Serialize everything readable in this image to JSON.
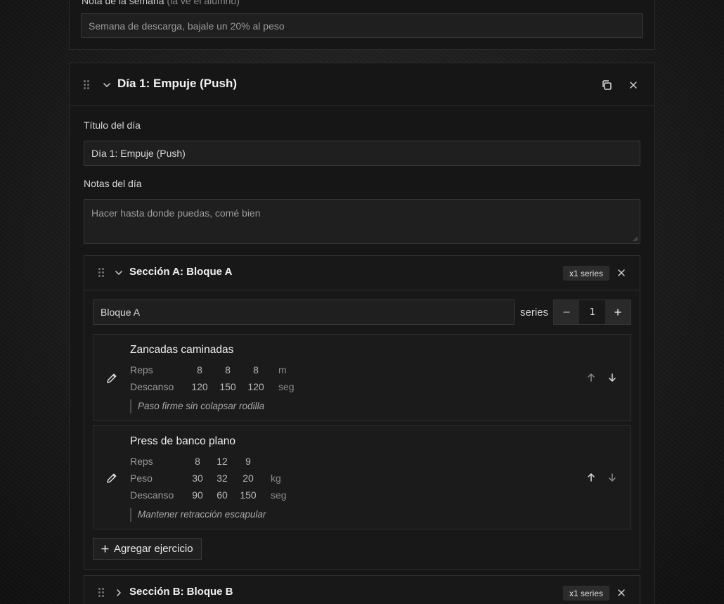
{
  "week": {
    "label": "Nota de la semana",
    "label_hint": "(la ve el alumno)",
    "note_value": "Semana de descarga, bajale un 20% al peso"
  },
  "day": {
    "title": "Día 1: Empuje (Push)",
    "title_field_label": "Título del día",
    "title_value": "Día 1: Empuje (Push)",
    "notes_field_label": "Notas del día",
    "notes_value": "Hacer hasta donde puedas, comé bien"
  },
  "sections": [
    {
      "title": "Sección A: Bloque A",
      "badge": "x1 series",
      "name_value": "Bloque A",
      "series_label": "series",
      "series_value": "1",
      "exercises": [
        {
          "name": "Zancadas caminadas",
          "rows": [
            {
              "label": "Reps",
              "values": [
                "8",
                "8",
                "8"
              ],
              "unit": "m"
            },
            {
              "label": "Descanso",
              "values": [
                "120",
                "150",
                "120"
              ],
              "unit": "seg"
            }
          ],
          "note": "Paso firme sin colapsar rodilla"
        },
        {
          "name": "Press de banco plano",
          "rows": [
            {
              "label": "Reps",
              "values": [
                "8",
                "12",
                "9"
              ],
              "unit": ""
            },
            {
              "label": "Peso",
              "values": [
                "30",
                "32",
                "20"
              ],
              "unit": "kg"
            },
            {
              "label": "Descanso",
              "values": [
                "90",
                "60",
                "150"
              ],
              "unit": "seg"
            }
          ],
          "note": "Mantener retracción escapular"
        }
      ],
      "add_exercise_label": "Agregar ejercicio"
    },
    {
      "title": "Sección B: Bloque B",
      "badge": "x1 series"
    }
  ],
  "colors": {
    "background": "#1c1c1c",
    "panel": "#161616",
    "input": "#1f1f1f",
    "badge": "#2c2c2c"
  }
}
